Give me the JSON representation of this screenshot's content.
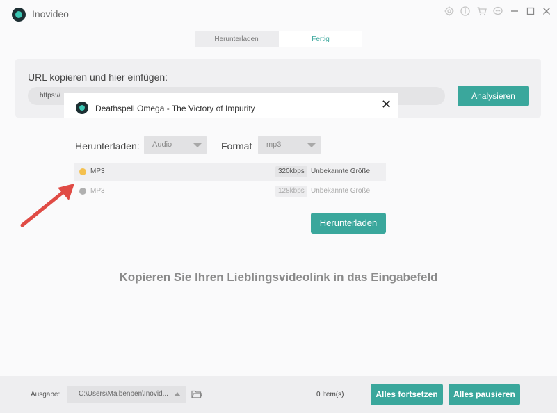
{
  "app": {
    "title": "Inovideo"
  },
  "titlebar": {
    "icons": [
      "settings-icon",
      "info-icon",
      "cart-icon",
      "chat-icon",
      "minimize-icon",
      "maximize-icon",
      "close-icon"
    ]
  },
  "tabs": [
    {
      "label": "Herunterladen",
      "active": false
    },
    {
      "label": "Fertig",
      "active": true
    }
  ],
  "url_panel": {
    "label": "URL kopieren und hier einfügen:",
    "input_value": "https://",
    "analyze_label": "Analysieren"
  },
  "modal": {
    "title": "Deathspell Omega - The Victory of Impurity",
    "download_label": "Herunterladen:",
    "download_select": "Audio",
    "format_label": "Format",
    "format_select": "mp3",
    "options": [
      {
        "name": "MP3",
        "bitrate": "320kbps",
        "size": "Unbekannte Größe",
        "selected": true,
        "dot_color": "#f4c04e"
      },
      {
        "name": "MP3",
        "bitrate": "128kbps",
        "size": "Unbekannte Größe",
        "selected": false,
        "dot_color": "#b0b0b0"
      }
    ],
    "download_button": "Herunterladen"
  },
  "hint": "Kopieren Sie Ihren Lieblingsvideolink in das Eingabefeld",
  "bottombar": {
    "output_label": "Ausgabe:",
    "output_path": "C:\\Users\\Maibenben\\Inovid...",
    "items_count": "0 Item(s)",
    "resume_all": "Alles fortsetzen",
    "pause_all": "Alles pausieren"
  },
  "colors": {
    "accent": "#3aa79c",
    "arrow": "#e04b45"
  }
}
